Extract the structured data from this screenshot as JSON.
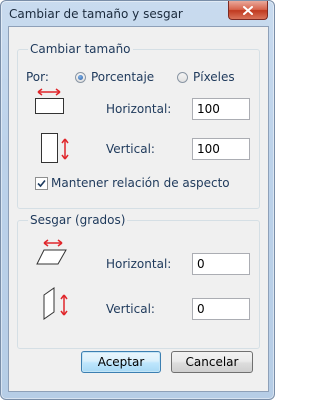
{
  "window": {
    "title": "Cambiar de tamaño y sesgar"
  },
  "resize": {
    "group_title": "Cambiar tamaño",
    "by_label": "Por:",
    "percentage_label": "Porcentaje",
    "pixels_label": "Píxeles",
    "selected_unit": "Porcentaje",
    "horizontal_label": "Horizontal:",
    "horizontal_value": "100",
    "vertical_label": "Vertical:",
    "vertical_value": "100",
    "keep_aspect_label": "Mantener relación de aspecto",
    "keep_aspect_checked": true
  },
  "skew": {
    "group_title": "Sesgar (grados)",
    "horizontal_label": "Horizontal:",
    "horizontal_value": "0",
    "vertical_label": "Vertical:",
    "vertical_value": "0"
  },
  "buttons": {
    "ok_label": "Aceptar",
    "cancel_label": "Cancelar"
  },
  "icons": {
    "close": "close-icon",
    "resize_horizontal": "resize-horizontal-icon",
    "resize_vertical": "resize-vertical-icon",
    "skew_horizontal": "skew-horizontal-icon",
    "skew_vertical": "skew-vertical-icon"
  },
  "colors": {
    "arrow": "#e0262b",
    "close_button": "#c9432c",
    "default_button_border": "#3c7fb1"
  }
}
